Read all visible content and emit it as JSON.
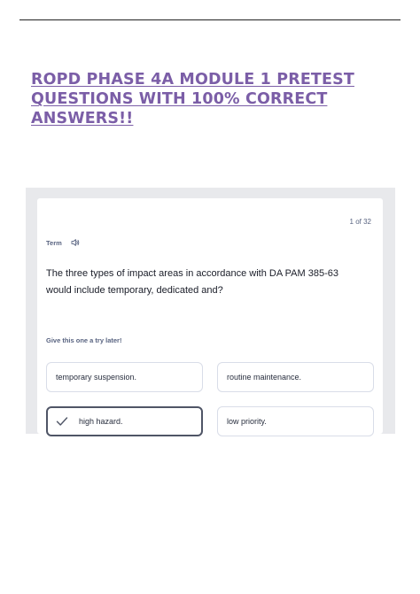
{
  "document": {
    "title": "ROPD PHASE 4A MODULE 1 PRETEST QUESTIONS WITH 100% CORRECT ANSWERS!!",
    "title_color": "#7b5ea7"
  },
  "flashcard": {
    "counter": "1 of 32",
    "term_label": "Term",
    "audio_icon": "speaker-icon",
    "question": "The three types of impact areas in accordance with DA PAM 385-63 would include temporary, dedicated and?",
    "hint": "Give this one a try later!",
    "options": [
      {
        "label": "temporary suspension.",
        "selected": false
      },
      {
        "label": "routine maintenance.",
        "selected": false
      },
      {
        "label": "high hazard.",
        "selected": true,
        "icon": "checkmark-icon"
      },
      {
        "label": "low priority.",
        "selected": false
      }
    ]
  }
}
